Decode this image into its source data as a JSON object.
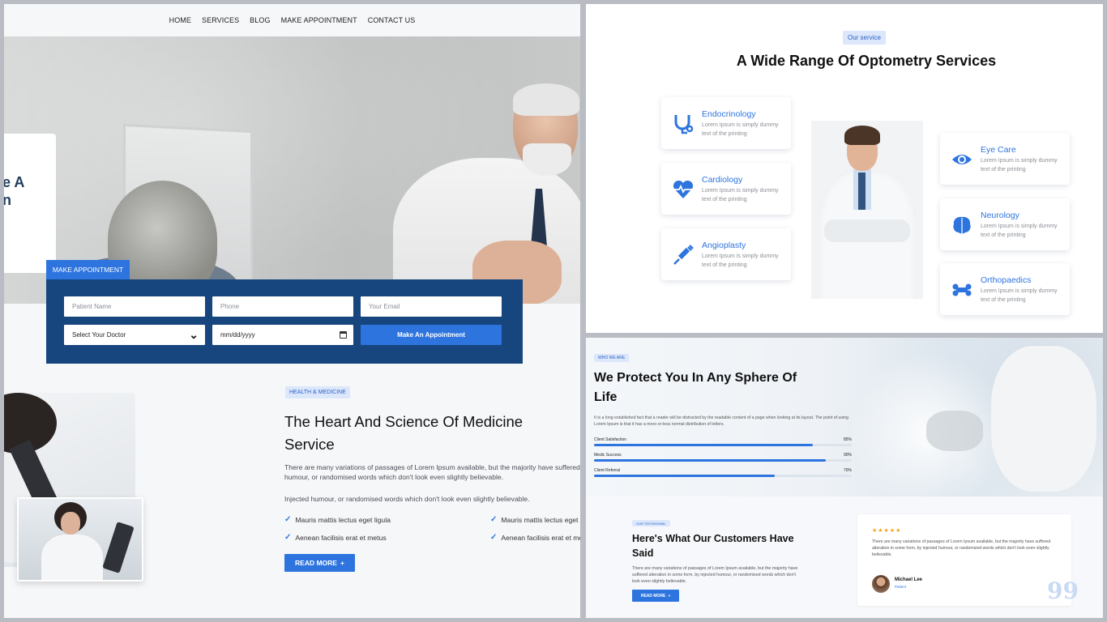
{
  "nav": {
    "items": [
      "HOME",
      "SERVICES",
      "BLOG",
      "MAKE APPOINTMENT",
      "CONTACT US"
    ]
  },
  "hero": {
    "card_line1": "e A",
    "card_line2": "n"
  },
  "appointment": {
    "tab_label": "MAKE APPOINTMENT",
    "patient_name_placeholder": "Patient Name",
    "phone_placeholder": "Phone",
    "email_placeholder": "Your Email",
    "doctor_select_value": "Select Your Doctor",
    "date_value": "mm/dd/yyyy",
    "submit_label": "Make An Appointment"
  },
  "heart_science": {
    "badge": "HEALTH & MEDICINE",
    "title": "The Heart And Science Of Medicine Service",
    "paragraph1": "There are many variations of passages of Lorem Ipsum available, but the majority have suffered alteration in some form, by injected humour, or randomised words which don't look even slightly believable.",
    "paragraph2": "Injected humour, or randomised words which don't look even slightly believable.",
    "checks": [
      "Mauris mattis lectus eget ligula",
      "Mauris mattis lectus eget ligula",
      "Aenean facilisis erat et metus",
      "Aenean facilisis erat et metus"
    ],
    "read_more_label": "READ MORE",
    "read_more_icon": "+"
  },
  "services": {
    "badge": "Our service",
    "title": "A Wide Range Of Optometry Services",
    "items": [
      {
        "name": "Endocrinology",
        "desc": "Lorem Ipsum is simply dummy text of the printing",
        "icon": "stethoscope-icon"
      },
      {
        "name": "Cardiology",
        "desc": "Lorem Ipsum is simply dummy text of the printing",
        "icon": "heartbeat-icon"
      },
      {
        "name": "Angioplasty",
        "desc": "Lorem Ipsum is simply dummy text of the printing",
        "icon": "syringe-icon"
      },
      {
        "name": "Eye Care",
        "desc": "Lorem Ipsum is simply dummy text of the printing",
        "icon": "eye-icon"
      },
      {
        "name": "Neurology",
        "desc": "Lorem Ipsum is simply dummy text of the printing",
        "icon": "brain-icon"
      },
      {
        "name": "Orthopaedics",
        "desc": "Lorem Ipsum is simply dummy text of the printing",
        "icon": "bone-icon"
      }
    ]
  },
  "who_we_are": {
    "badge": "WHO WE ARE",
    "title": "We Protect You In Any Sphere Of Life",
    "paragraph": "It is a long established fact that a reader will be distracted by the readable content of a page when looking at its layout. The point of using Lorem Ipsum is that it has a more-or-less normal distribution of letters.",
    "bars": [
      {
        "label": "Client Satisfaction",
        "percent": "85%",
        "value": 0.85
      },
      {
        "label": "Medic Success",
        "percent": "90%",
        "value": 0.9
      },
      {
        "label": "Client Referral",
        "percent": "70%",
        "value": 0.7
      }
    ]
  },
  "testimonials": {
    "badge": "OUR TESTIMONIAL",
    "title": "Here's What Our Customers Have Said",
    "paragraph": "There are many variations of passages of Lorem Ipsum available, but the majority have suffered alteration in some form, by injected humour, or randomised words which don't look even slightly believable.",
    "read_more_label": "READ MORE",
    "read_more_icon": "»",
    "quote": {
      "stars": "★★★★★",
      "text": "There are many variations of passages of Lorem Ipsum available, but the majority have suffered alteration in some form, by injected humour, or randomized words which don't look even slightly believable.",
      "name": "Michael Lee",
      "role": "Patient",
      "mark": "99"
    }
  },
  "colors": {
    "accent": "#2d74df",
    "navy": "#17457e",
    "badge_bg": "#dce7fb",
    "star": "#f3a31b"
  }
}
